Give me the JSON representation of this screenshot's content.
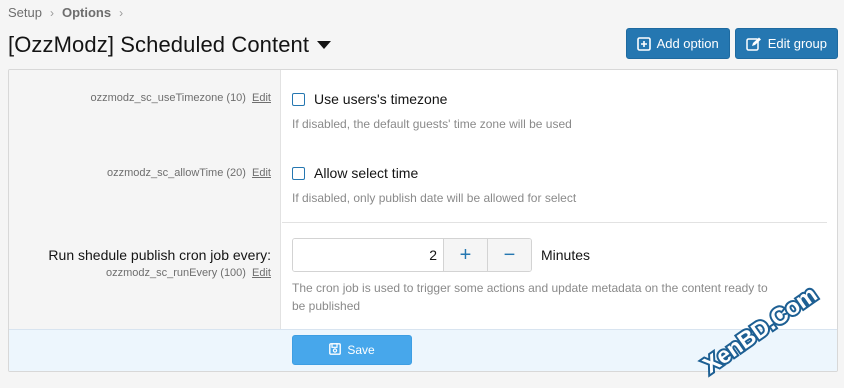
{
  "breadcrumb": {
    "items": [
      "Setup",
      "Options"
    ]
  },
  "page": {
    "title": "[OzzModz] Scheduled Content"
  },
  "actions": {
    "add_option": "Add option",
    "edit_group": "Edit group"
  },
  "options": [
    {
      "meta": "ozzmodz_sc_useTimezone (10)",
      "edit": "Edit",
      "label": "Use users's timezone",
      "hint": "If disabled, the default guests' time zone will be used"
    },
    {
      "meta": "ozzmodz_sc_allowTime (20)",
      "edit": "Edit",
      "label": "Allow select time",
      "hint": "If disabled, only publish date will be allowed for select"
    },
    {
      "title": "Run shedule publish cron job every:",
      "meta": "ozzmodz_sc_runEvery (100)",
      "edit": "Edit",
      "value": "2",
      "plus": "+",
      "minus": "−",
      "units": "Minutes",
      "hint_line1": "The cron job is used to trigger some actions and update metadata on the content ready to",
      "hint_line2": "be published"
    }
  ],
  "footer": {
    "save_label": "Save"
  },
  "watermark": {
    "text": "XenBD.Com"
  },
  "colors": {
    "accent": "#2577b1",
    "save": "#47a7eb",
    "footer_bg": "#edf6fd"
  }
}
